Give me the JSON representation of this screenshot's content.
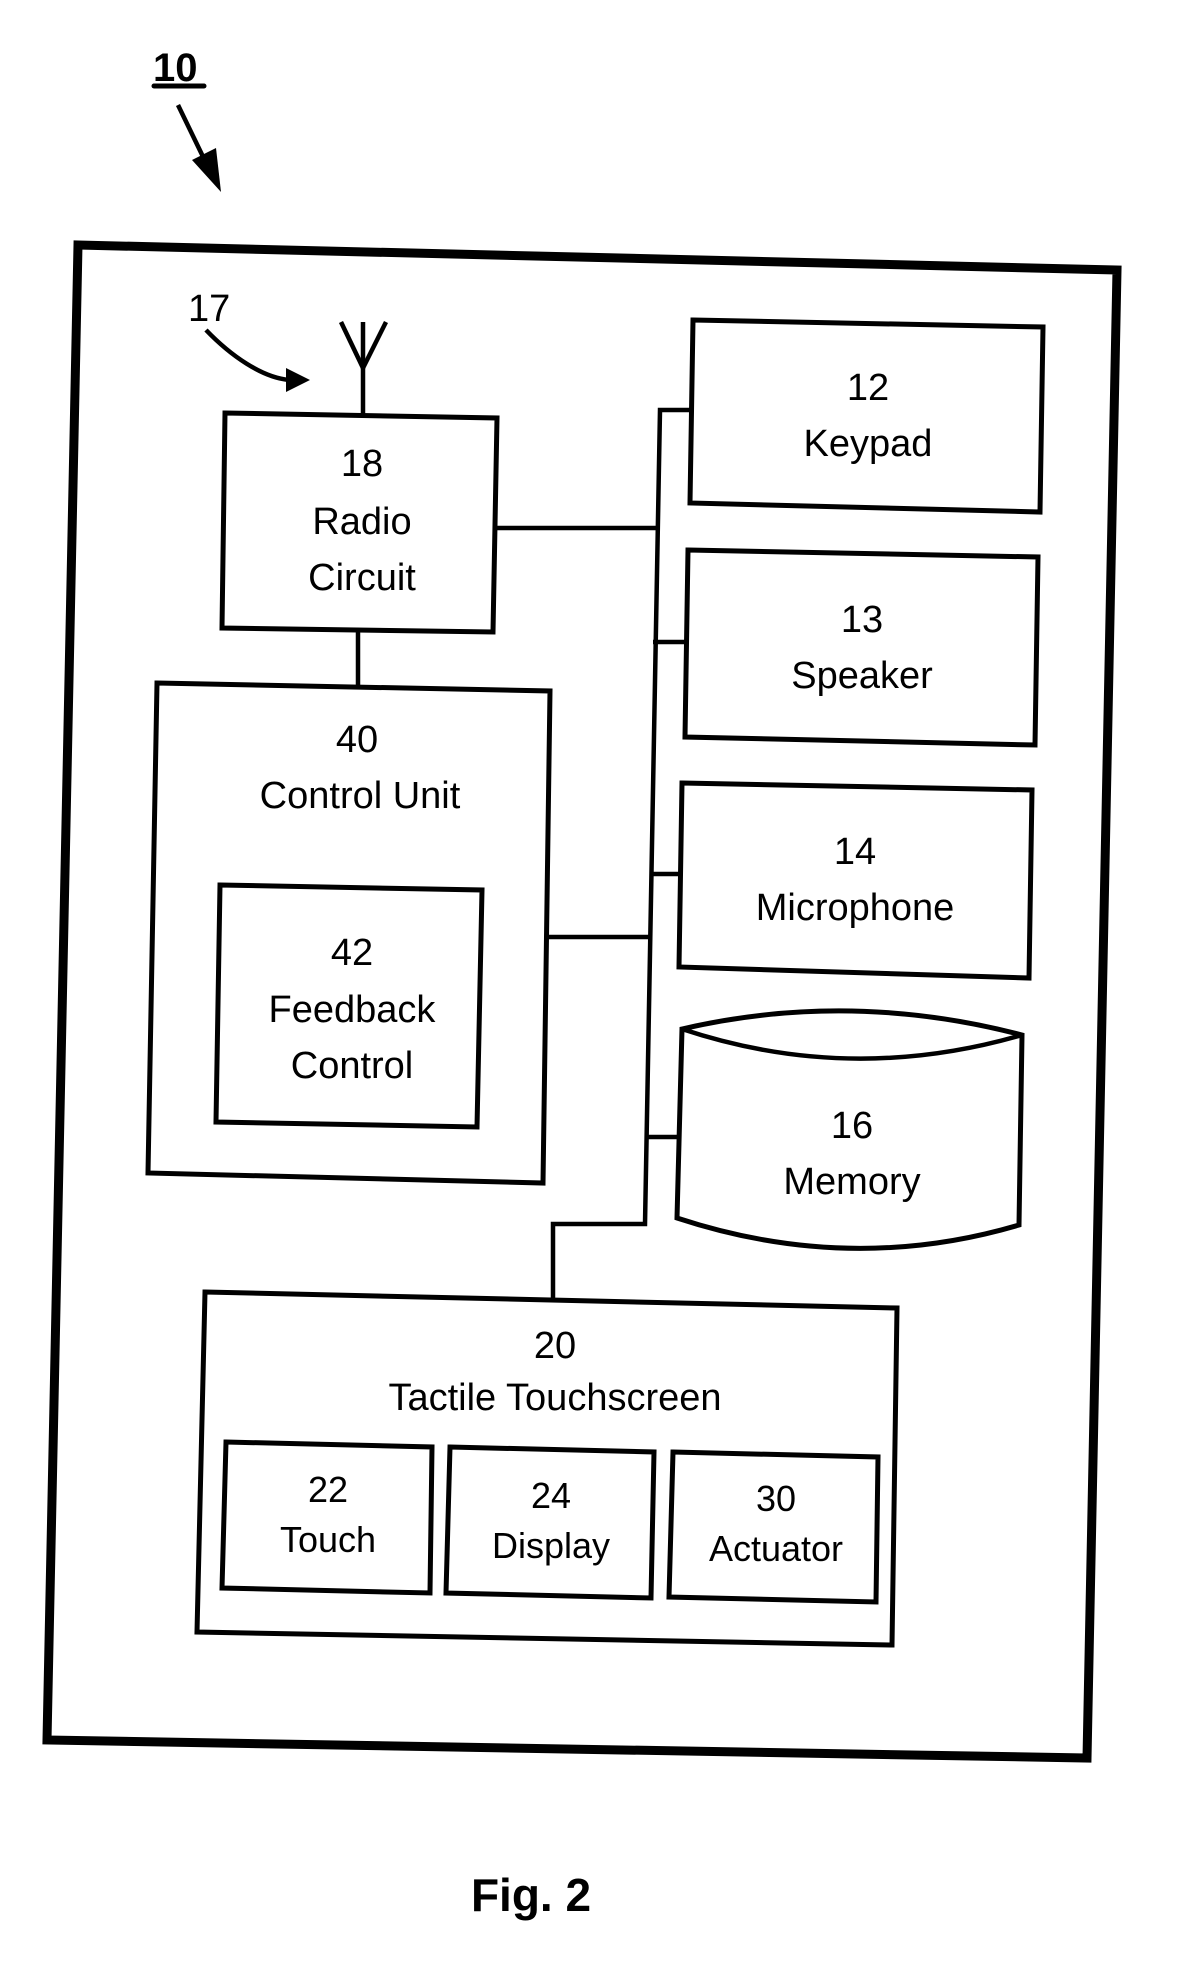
{
  "figure": {
    "caption": "Fig. 2",
    "device_ref": "10",
    "antenna_ref": "17"
  },
  "blocks": {
    "radio": {
      "number": "18",
      "line1": "Radio",
      "line2": "Circuit"
    },
    "control_unit": {
      "number": "40",
      "label": "Control Unit"
    },
    "feedback": {
      "number": "42",
      "line1": "Feedback",
      "line2": "Control"
    },
    "keypad": {
      "number": "12",
      "label": "Keypad"
    },
    "speaker": {
      "number": "13",
      "label": "Speaker"
    },
    "microphone": {
      "number": "14",
      "label": "Microphone"
    },
    "memory": {
      "number": "16",
      "label": "Memory"
    },
    "touchscreen": {
      "number": "20",
      "label": "Tactile Touchscreen"
    },
    "touch": {
      "number": "22",
      "label": "Touch"
    },
    "display": {
      "number": "24",
      "label": "Display"
    },
    "actuator": {
      "number": "30",
      "label": "Actuator"
    }
  }
}
